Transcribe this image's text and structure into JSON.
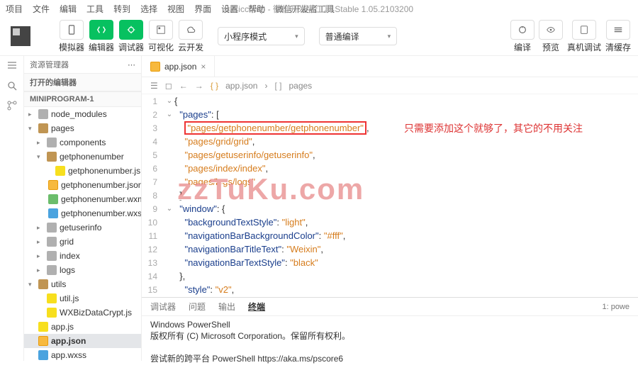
{
  "menubar": [
    "项目",
    "文件",
    "编辑",
    "工具",
    "转到",
    "选择",
    "视图",
    "界面",
    "设置",
    "帮助",
    "微信开发者工具"
  ],
  "title": "basiccomp - 微信开发者工具 Stable 1.05.2103200",
  "toolbar": {
    "mode_labels": [
      "模拟器",
      "编辑器",
      "调试器",
      "可视化",
      "云开发"
    ],
    "select1": "小程序模式",
    "select2": "普通编译",
    "right_labels": [
      "编译",
      "预览",
      "真机调试",
      "清缓存"
    ]
  },
  "explorer": {
    "title": "资源管理器",
    "section1": "打开的编辑器",
    "section2": "MINIPROGRAM-1",
    "nodes": [
      {
        "d": 0,
        "c": "▸",
        "label": "node_modules",
        "ic": "ic-folder-g"
      },
      {
        "d": 0,
        "c": "▾",
        "label": "pages",
        "ic": "ic-folder"
      },
      {
        "d": 1,
        "c": "▸",
        "label": "components",
        "ic": "ic-folder-g"
      },
      {
        "d": 1,
        "c": "▾",
        "label": "getphonenumber",
        "ic": "ic-folder"
      },
      {
        "d": 2,
        "c": "",
        "label": "getphonenumber.js",
        "ic": "ic-js"
      },
      {
        "d": 2,
        "c": "",
        "label": "getphonenumber.json",
        "ic": "ic-json"
      },
      {
        "d": 2,
        "c": "",
        "label": "getphonenumber.wxml",
        "ic": "ic-wxml"
      },
      {
        "d": 2,
        "c": "",
        "label": "getphonenumber.wxss",
        "ic": "ic-wxss"
      },
      {
        "d": 1,
        "c": "▸",
        "label": "getuserinfo",
        "ic": "ic-folder-g"
      },
      {
        "d": 1,
        "c": "▸",
        "label": "grid",
        "ic": "ic-folder-g"
      },
      {
        "d": 1,
        "c": "▸",
        "label": "index",
        "ic": "ic-folder-g"
      },
      {
        "d": 1,
        "c": "▸",
        "label": "logs",
        "ic": "ic-folder-g"
      },
      {
        "d": 0,
        "c": "▾",
        "label": "utils",
        "ic": "ic-folder"
      },
      {
        "d": 1,
        "c": "",
        "label": "util.js",
        "ic": "ic-js"
      },
      {
        "d": 1,
        "c": "",
        "label": "WXBizDataCrypt.js",
        "ic": "ic-js"
      },
      {
        "d": 0,
        "c": "",
        "label": "app.js",
        "ic": "ic-js"
      },
      {
        "d": 0,
        "c": "",
        "label": "app.json",
        "ic": "ic-json",
        "sel": true
      },
      {
        "d": 0,
        "c": "",
        "label": "app.wxss",
        "ic": "ic-wxss"
      }
    ]
  },
  "tabs": {
    "active": "app.json"
  },
  "breadcrumb": {
    "file": "app.json",
    "sym": "pages"
  },
  "code": {
    "lines": [
      {
        "n": 1,
        "t": "{",
        "cls": ""
      },
      {
        "n": 2,
        "t": "  \"pages\": [",
        "key": "pages",
        "after": ": ["
      },
      {
        "n": 3,
        "hl": true,
        "t": "    \"pages/getphonenumber/getphonenumber\","
      },
      {
        "n": 4,
        "t": "    \"pages/grid/grid\","
      },
      {
        "n": 5,
        "t": "    \"pages/getuserinfo/getuserinfo\","
      },
      {
        "n": 6,
        "t": "    \"pages/index/index\","
      },
      {
        "n": 7,
        "t": "    \"pages/logs/logs\""
      },
      {
        "n": 8,
        "t": "  ],"
      },
      {
        "n": 9,
        "t": "  \"window\": {",
        "key": "window",
        "after": ": {"
      },
      {
        "n": 10,
        "t": "    \"backgroundTextStyle\": \"light\",",
        "k": "backgroundTextStyle",
        "v": "light"
      },
      {
        "n": 11,
        "t": "    \"navigationBarBackgroundColor\": \"#fff\",",
        "k": "navigationBarBackgroundColor",
        "v": "#fff"
      },
      {
        "n": 12,
        "t": "    \"navigationBarTitleText\": \"Weixin\",",
        "k": "navigationBarTitleText",
        "v": "Weixin"
      },
      {
        "n": 13,
        "t": "    \"navigationBarTextStyle\": \"black\"",
        "k": "navigationBarTextStyle",
        "v": "black"
      },
      {
        "n": 14,
        "t": "  },"
      },
      {
        "n": 15,
        "t": "  \"style\": \"v2\",",
        "k": "style",
        "v": "v2"
      }
    ]
  },
  "annotation": "只需要添加这个就够了，其它的不用关注",
  "watermark": "zzTuKu.com",
  "terminal": {
    "tabs": [
      "调试器",
      "问题",
      "输出",
      "终端"
    ],
    "right": "1: powe",
    "lines": [
      "Windows PowerShell",
      "版权所有 (C) Microsoft Corporation。保留所有权利。",
      "",
      "尝试新的跨平台 PowerShell https://aka.ms/pscore6"
    ]
  }
}
